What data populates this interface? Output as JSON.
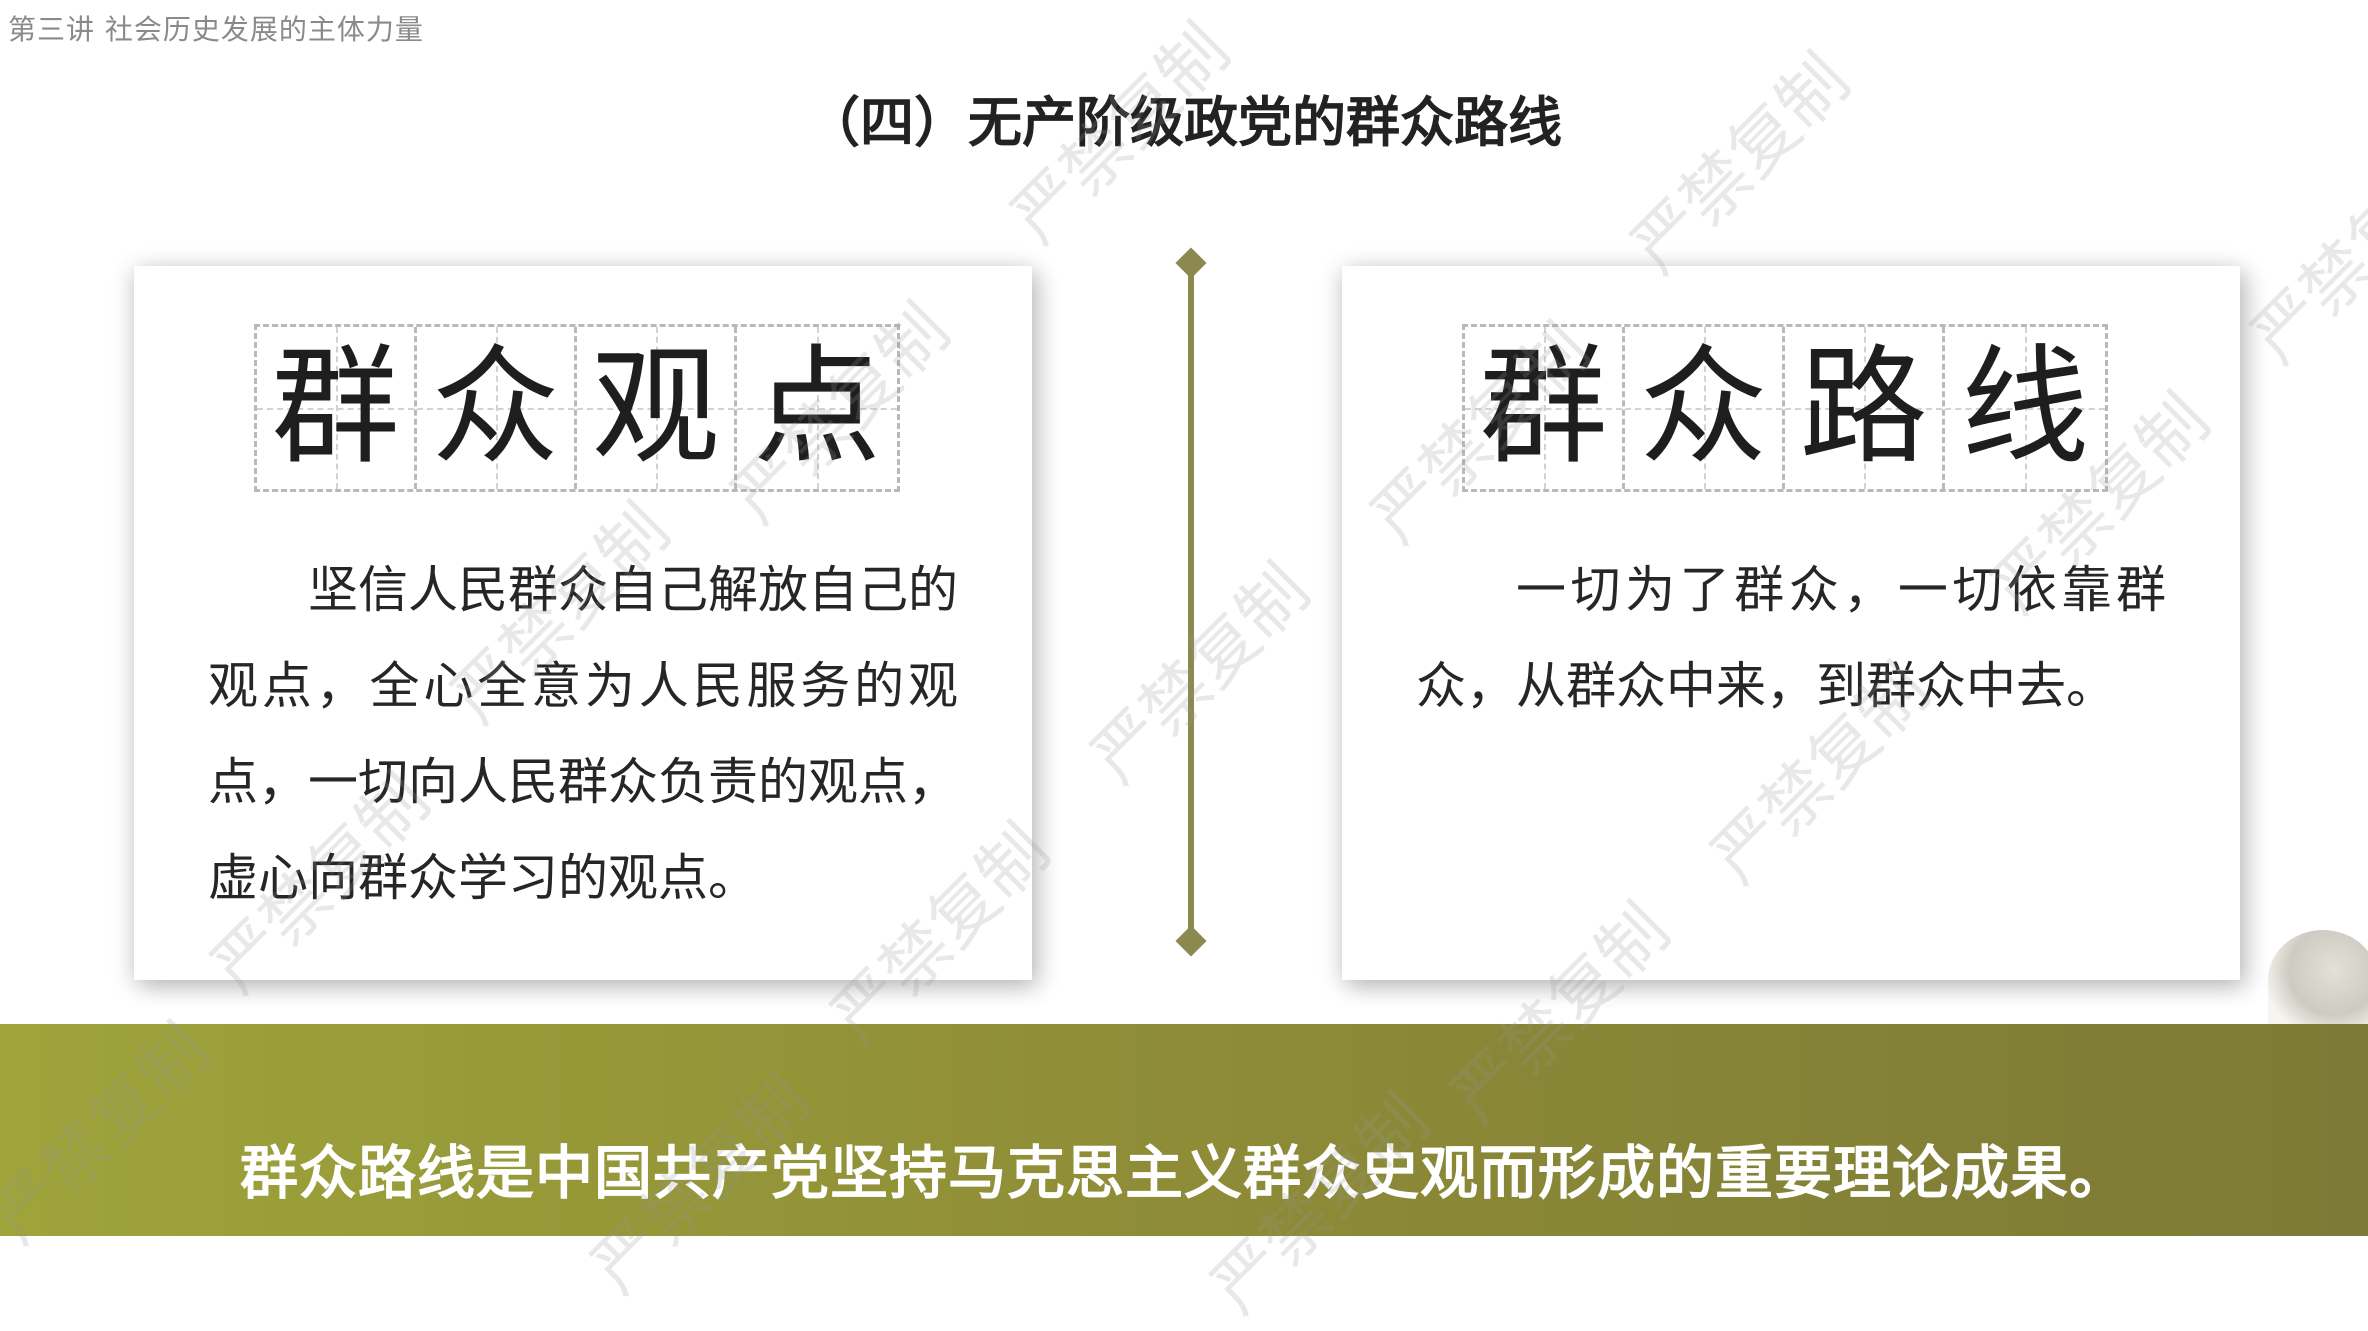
{
  "header": {
    "breadcrumb": "第三讲 社会历史发展的主体力量"
  },
  "title": "（四）无产阶级政党的群众路线",
  "left_card": {
    "heading_chars": [
      "群",
      "众",
      "观",
      "点"
    ],
    "body": "坚信人民群众自己解放自己的观点，全心全意为人民服务的观点，一切向人民群众负责的观点，虚心向群众学习的观点。"
  },
  "right_card": {
    "heading_chars": [
      "群",
      "众",
      "路",
      "线"
    ],
    "body": "一切为了群众，一切依靠群众，从群众中来，到群众中去。"
  },
  "footer": {
    "text": "群众路线是中国共产党坚持马克思主义群众史观而形成的重要理论成果。"
  },
  "watermark": "严禁复制",
  "colors": {
    "accent": "#8b8950",
    "band_start": "#9ea43a",
    "band_end": "#7c7a36"
  }
}
